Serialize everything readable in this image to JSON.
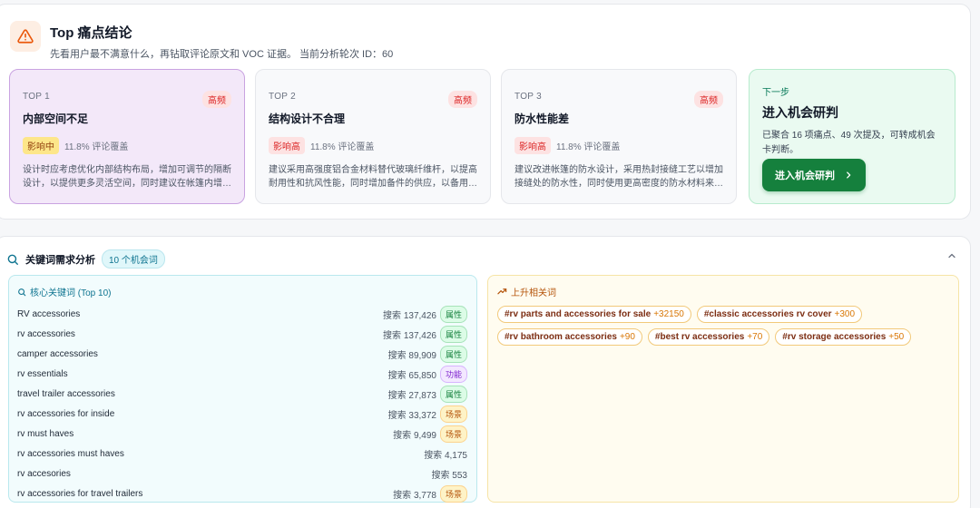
{
  "header": {
    "title": "Top 痛点结论",
    "subtitle": "先看用户最不满意什么，再钻取评论原文和 VOC 证据。 当前分析轮次 ID：60"
  },
  "pain_cards": [
    {
      "rank": "TOP 1",
      "freq": "高频",
      "name": "内部空间不足",
      "impact": "影响中",
      "coverage": "11.8% 评论覆盖",
      "desc": "设计时应考虑优化内部结构布局，增加可调节的隔断设计，以提供更多灵活空间，同时建议在帐篷内增…"
    },
    {
      "rank": "TOP 2",
      "freq": "高频",
      "name": "结构设计不合理",
      "impact": "影响高",
      "coverage": "11.8% 评论覆盖",
      "desc": "建议采用高强度铝合金材料替代玻璃纤维杆，以提高耐用性和抗风性能，同时增加备件的供应，以备用…"
    },
    {
      "rank": "TOP 3",
      "freq": "高频",
      "name": "防水性能差",
      "impact": "影响高",
      "coverage": "11.8% 评论覆盖",
      "desc": "建议改进帐篷的防水设计，采用热封接缝工艺以增加接缝处的防水性，同时使用更高密度的防水材料来…"
    }
  ],
  "next_step": {
    "label": "下一步",
    "title": "进入机会研判",
    "text": "已聚合 16 项痛点、49 次提及，可转成机会卡判断。",
    "button": "进入机会研判"
  },
  "keywords": {
    "title": "关键词需求分析",
    "badge": "10 个机会词",
    "core_title": "核心关键词 (Top 10)",
    "rows": [
      {
        "kw": "RV accessories",
        "vol": "搜索 137,426",
        "tag": "属性",
        "tag_type": "attr"
      },
      {
        "kw": "rv accessories",
        "vol": "搜索 137,426",
        "tag": "属性",
        "tag_type": "attr"
      },
      {
        "kw": "camper accessories",
        "vol": "搜索 89,909",
        "tag": "属性",
        "tag_type": "attr"
      },
      {
        "kw": "rv essentials",
        "vol": "搜索 65,850",
        "tag": "功能",
        "tag_type": "func"
      },
      {
        "kw": "travel trailer accessories",
        "vol": "搜索 27,873",
        "tag": "属性",
        "tag_type": "attr"
      },
      {
        "kw": "rv accessories for inside",
        "vol": "搜索 33,372",
        "tag": "场景",
        "tag_type": "scene"
      },
      {
        "kw": "rv must haves",
        "vol": "搜索 9,499",
        "tag": "场景",
        "tag_type": "scene"
      },
      {
        "kw": "rv accessories must haves",
        "vol": "搜索 4,175",
        "tag": "",
        "tag_type": ""
      },
      {
        "kw": "rv accesories",
        "vol": "搜索 553",
        "tag": "",
        "tag_type": ""
      },
      {
        "kw": "rv accessories for travel trailers",
        "vol": "搜索 3,778",
        "tag": "场景",
        "tag_type": "scene"
      }
    ],
    "rising_title": "上升相关词",
    "rising": [
      {
        "term": "#rv parts and accessories for sale",
        "inc": "+32150"
      },
      {
        "term": "#classic accessories rv cover",
        "inc": "+300"
      },
      {
        "term": "#rv bathroom accessories",
        "inc": "+90"
      },
      {
        "term": "#best rv accessories",
        "inc": "+70"
      },
      {
        "term": "#rv storage accessories",
        "inc": "+50"
      }
    ]
  },
  "colors": {
    "accent_green": "#15803d",
    "freq_red": "#dc2626",
    "warn_orange": "#ea580c"
  }
}
